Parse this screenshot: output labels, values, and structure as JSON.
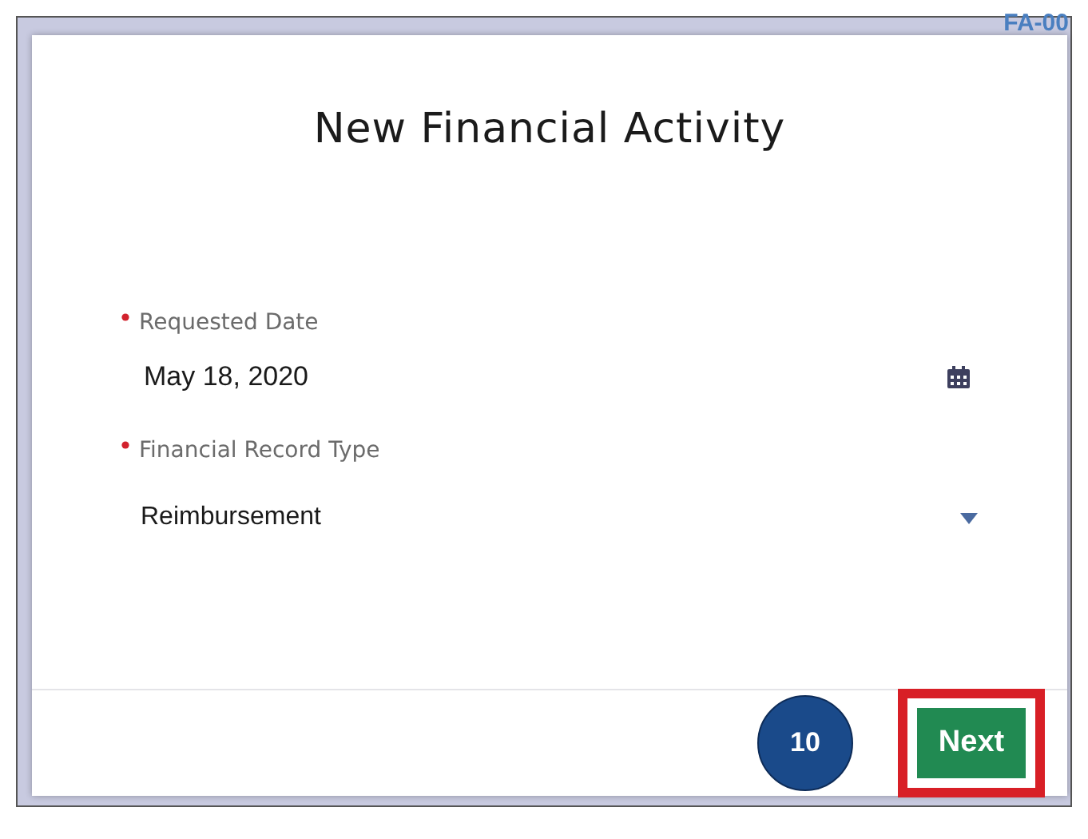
{
  "background": {
    "record_id": "FA-00"
  },
  "modal": {
    "title": "New Financial Activity",
    "fields": [
      {
        "kind": "date",
        "label": "Requested Date",
        "required": true,
        "value": "May 18, 2020"
      },
      {
        "kind": "select",
        "label": "Financial Record Type",
        "required": true,
        "value": "Reimbursement"
      }
    ],
    "footer": {
      "step_badge": "10",
      "next_button": {
        "label": "Next",
        "highlighted": true
      }
    }
  }
}
